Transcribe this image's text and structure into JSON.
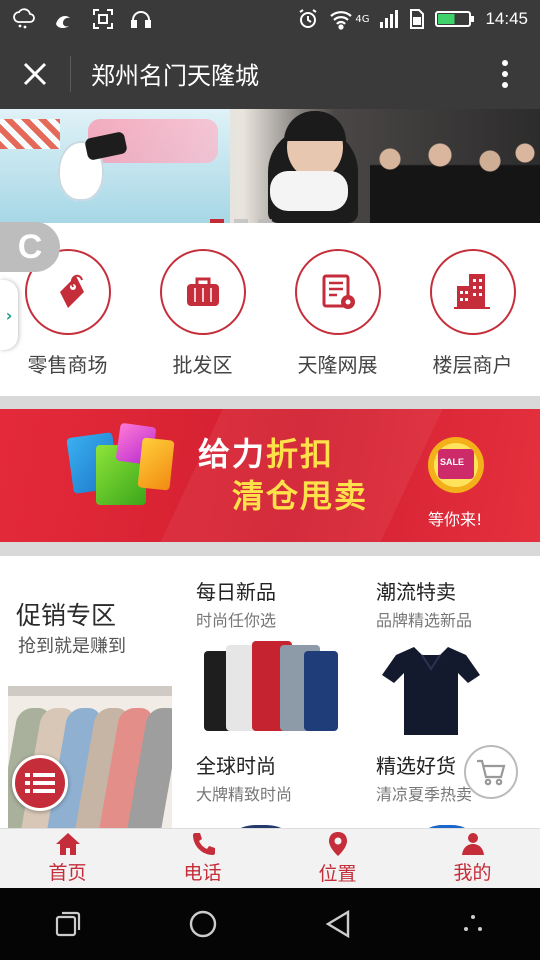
{
  "status_bar": {
    "time": "14:45",
    "network": "4G",
    "battery_level": 0.55,
    "icons": [
      "weather-icon",
      "uc-browser-icon",
      "scan-icon",
      "headphones-icon",
      "alarm-icon",
      "wifi-icon",
      "signal-icon",
      "sim-icon",
      "battery-icon"
    ]
  },
  "header": {
    "title": "郑州名门天隆城",
    "close_icon": "close-icon",
    "more_icon": "more-vertical-icon"
  },
  "banner": {
    "slide_count": 3,
    "active_slide": 1
  },
  "floating": {
    "c_label": "C",
    "side_arrow": "›"
  },
  "categories": [
    {
      "label": "零售商场",
      "icon": "price-tag-icon"
    },
    {
      "label": "批发区",
      "icon": "briefcase-icon"
    },
    {
      "label": "天隆网展",
      "icon": "document-icon"
    },
    {
      "label": "楼层商户",
      "icon": "building-icon"
    }
  ],
  "promo": {
    "line1_a": "给力",
    "line1_b": "折扣",
    "line2": "清仓甩卖",
    "caption": "等你来!",
    "badge_text": "SALE"
  },
  "products": {
    "zone_title": "促销专区",
    "zone_subtitle": "抢到就是赚到",
    "tiles": [
      {
        "title": "每日新品",
        "subtitle": "时尚任你选"
      },
      {
        "title": "潮流特卖",
        "subtitle": "品牌精选新品"
      },
      {
        "title": "全球时尚",
        "subtitle": "大牌精致时尚"
      },
      {
        "title": "精选好货",
        "subtitle": "清凉夏季热卖"
      }
    ]
  },
  "bottom_nav": [
    {
      "label": "首页",
      "icon": "home-icon"
    },
    {
      "label": "电话",
      "icon": "phone-icon"
    },
    {
      "label": "位置",
      "icon": "location-pin-icon"
    },
    {
      "label": "我的",
      "icon": "user-icon"
    }
  ],
  "colors": {
    "brand_red": "#c42d39",
    "header_bg": "#3a3a3a",
    "promo_yellow": "#ffe14a"
  }
}
